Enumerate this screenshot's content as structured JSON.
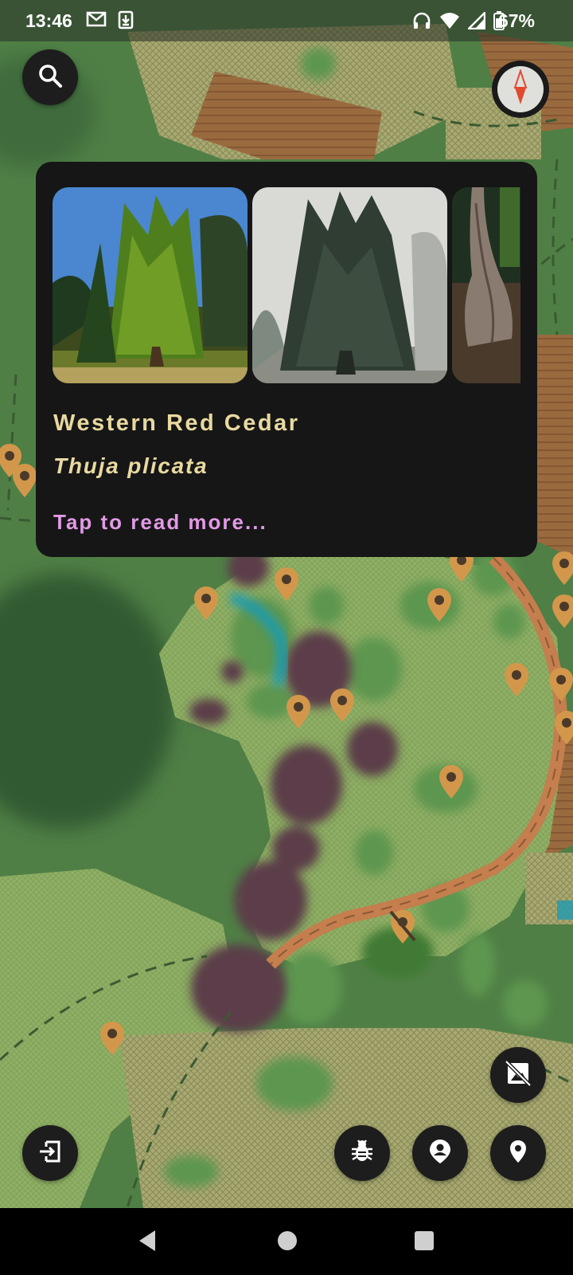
{
  "status_bar": {
    "time": "13:46",
    "battery_percent": "67%",
    "notification_icons": [
      "gmail-icon",
      "download-icon"
    ],
    "system_icons": [
      "headphones-icon",
      "wifi-icon",
      "signal-icon",
      "battery-icon"
    ]
  },
  "map": {
    "toolbar_top": [
      "search-icon",
      "compass-icon"
    ],
    "toolbar_bottom": [
      "exit-icon",
      "bug-icon",
      "person-pin-icon",
      "location-pin-icon"
    ],
    "toggle_button": "image-off-icon",
    "pin_color": "#d3974b",
    "grass_color": "#93b366",
    "forest_color": "#4e7e45",
    "shrub_color": "#5d3f4b",
    "path_color": "#c57e4d",
    "water_color": "#1f9bb0"
  },
  "card": {
    "common_name": "Western Red Cedar",
    "scientific_name": "Thuja plicata",
    "read_more": "Tap to read more...",
    "title_color": "#e8d9a0",
    "link_color": "#e29ae6",
    "photos": [
      "cedar-sunny-photo",
      "cedar-foggy-photo",
      "cedar-trunk-photo"
    ]
  },
  "nav_bar": {
    "buttons": [
      "back-icon",
      "home-icon",
      "recents-icon"
    ]
  }
}
